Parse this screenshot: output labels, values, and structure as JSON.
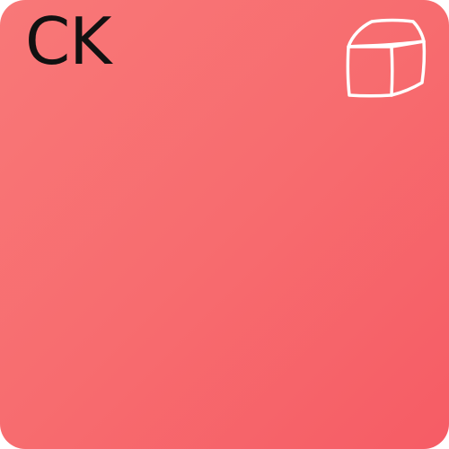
{
  "tile": {
    "abbreviation": "CK",
    "icon": "cube-icon",
    "colors": {
      "gradient_start": "#f87878",
      "gradient_end": "#f65c65",
      "text": "#111111",
      "icon_stroke": "#ffffff"
    }
  }
}
